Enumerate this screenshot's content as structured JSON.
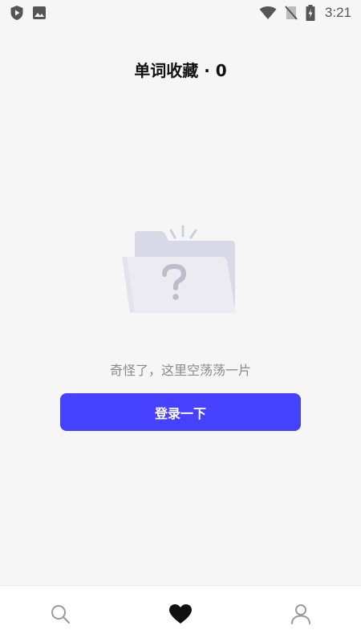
{
  "status_bar": {
    "time": "3:21",
    "left_icons": [
      "shield-play-icon",
      "image-icon"
    ],
    "right_icons": [
      "wifi-icon",
      "no-sim-icon",
      "battery-charging-icon"
    ]
  },
  "header": {
    "title": "单词收藏 · 0"
  },
  "empty_state": {
    "illustration": "empty-folder-question-icon",
    "message": "奇怪了，这里空荡荡一片",
    "login_button_label": "登录一下"
  },
  "bottom_nav": {
    "items": [
      {
        "icon": "search-icon",
        "active": false
      },
      {
        "icon": "heart-icon",
        "active": true
      },
      {
        "icon": "profile-icon",
        "active": false
      }
    ]
  },
  "colors": {
    "background": "#f6f6f6",
    "accent": "#4640ff",
    "muted_text": "#8a8a8a",
    "nav_inactive": "#9a9a9a",
    "nav_active": "#111111"
  }
}
